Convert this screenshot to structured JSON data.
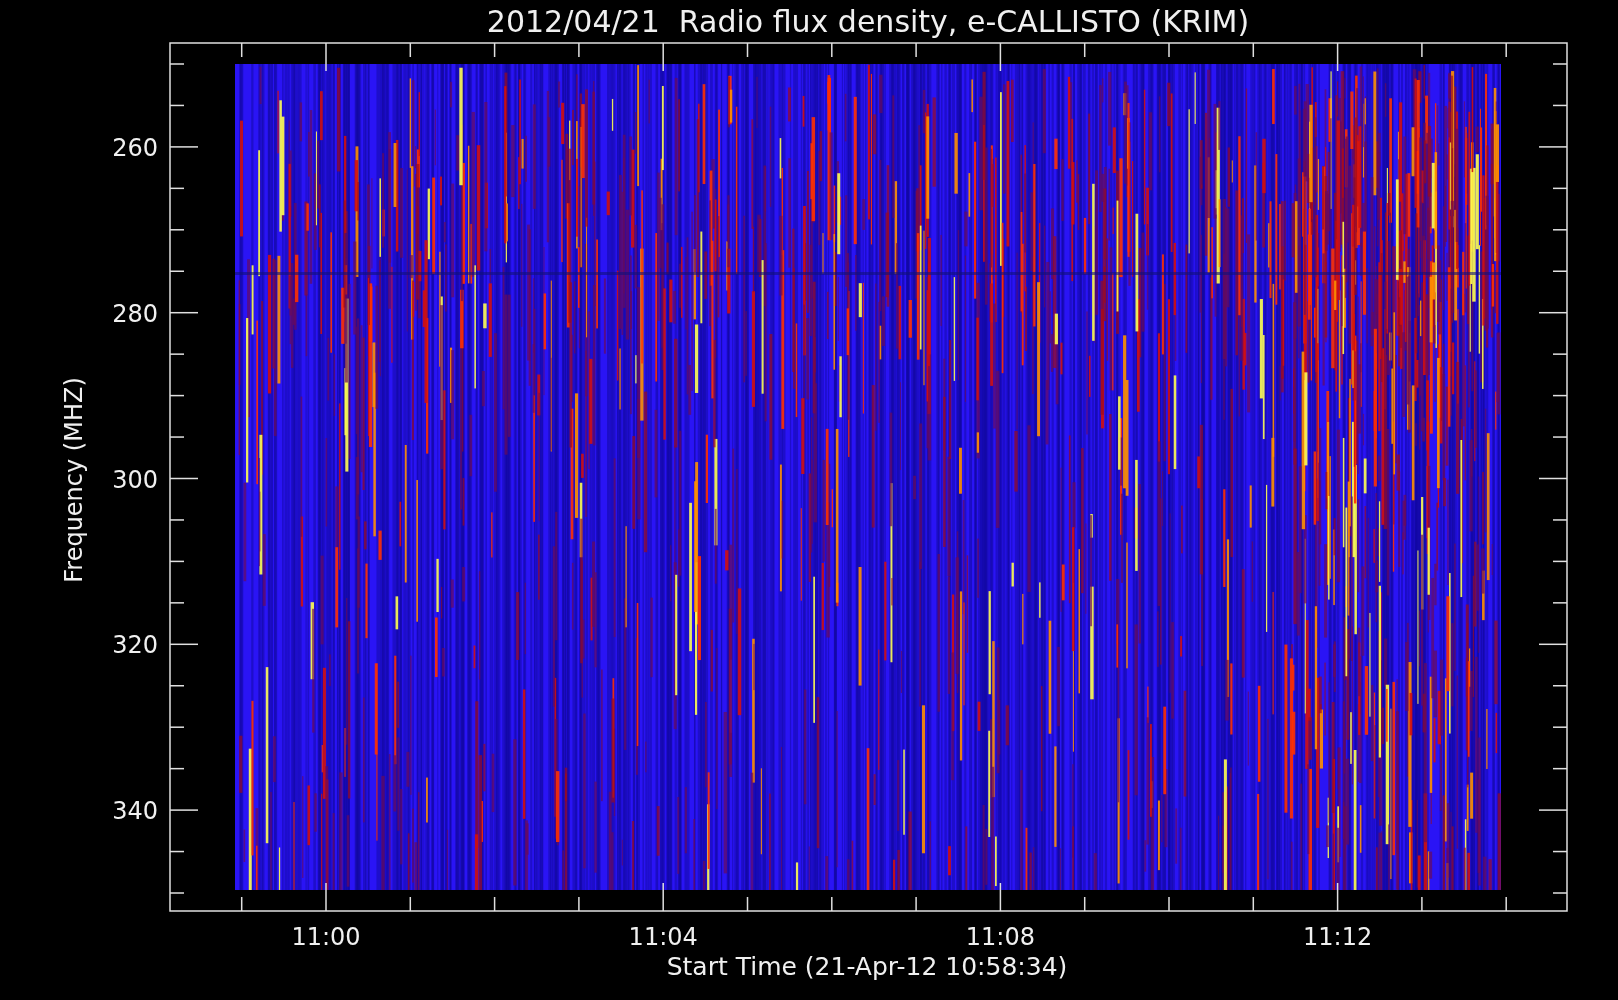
{
  "title": "2012/04/21  Radio flux density, e-CALLISTO (KRIM)",
  "ylabel": "Frequency (MHZ)",
  "xlabel": "Start Time (21-Apr-12 10:58:34)",
  "yticks": [
    "260",
    "280",
    "300",
    "320",
    "340"
  ],
  "xticks": [
    "11:00",
    "11:04",
    "11:08",
    "11:12"
  ]
}
